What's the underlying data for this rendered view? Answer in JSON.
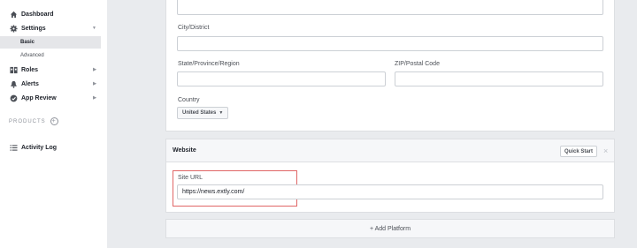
{
  "sidebar": {
    "items": [
      {
        "label": "Dashboard",
        "icon": "home-icon"
      },
      {
        "label": "Settings",
        "icon": "gear-icon"
      },
      {
        "label": "Basic"
      },
      {
        "label": "Advanced"
      },
      {
        "label": "Roles",
        "icon": "roles-icon"
      },
      {
        "label": "Alerts",
        "icon": "bell-icon"
      },
      {
        "label": "App Review",
        "icon": "check-shield-icon"
      }
    ],
    "products_label": "PRODUCTS",
    "activity_log_label": "Activity Log"
  },
  "form": {
    "city_label": "City/District",
    "state_label": "State/Province/Region",
    "zip_label": "ZIP/Postal Code",
    "country_label": "Country",
    "country_value": "United States"
  },
  "website": {
    "title": "Website",
    "quick_start_label": "Quick Start",
    "close_glyph": "×",
    "site_url_label": "Site URL",
    "site_url_value": "https://news.extly.com/"
  },
  "add_platform_label": "+ Add Platform"
}
